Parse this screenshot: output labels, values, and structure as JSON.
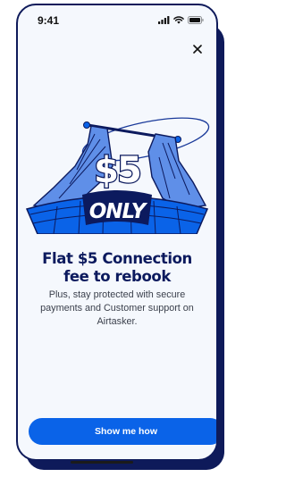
{
  "status_bar": {
    "time": "9:41",
    "icons": [
      "cellular-signal-icon",
      "wifi-icon",
      "battery-icon"
    ]
  },
  "modal": {
    "close_icon": "close-icon",
    "illustration": {
      "sign_price": "$5",
      "sign_label": "ONLY"
    },
    "headline": "Flat $5 Connection fee to rebook",
    "subtext": "Plus, stay protected with secure payments and Customer support on Airtasker.",
    "cta_label": "Show me how"
  },
  "colors": {
    "primary": "#0a63e8",
    "navy": "#0c1a5e",
    "background": "#f5f8fd"
  }
}
